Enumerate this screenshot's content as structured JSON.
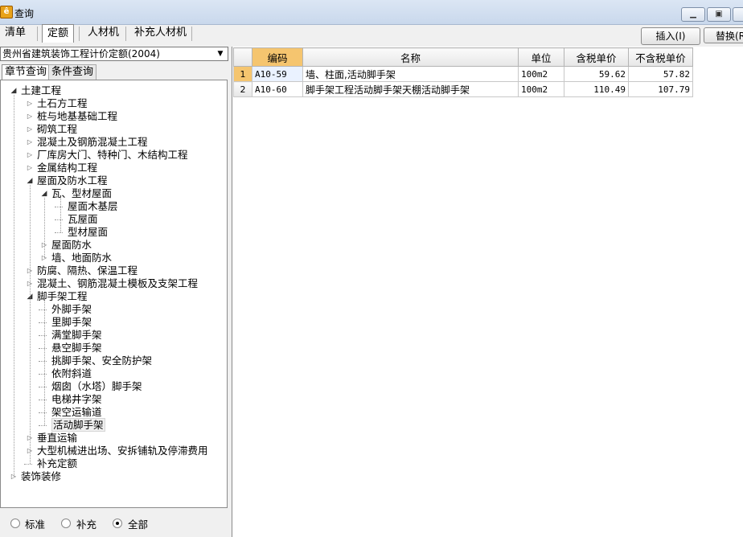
{
  "window": {
    "title": "查询",
    "icon": "app-icon",
    "buttons": {
      "minimize": "▭",
      "restore": "▣",
      "close": ""
    }
  },
  "tabs": [
    {
      "label": "清单",
      "active": false
    },
    {
      "label": "定额",
      "active": true
    },
    {
      "label": "人材机",
      "active": false
    },
    {
      "label": "补充人材机",
      "active": false
    }
  ],
  "toolbar": {
    "insert_label": "插入(I)",
    "replace_label": "替换(R"
  },
  "left": {
    "dropdown_value": "贵州省建筑装饰工程计价定额(2004)",
    "subtabs": [
      {
        "label": "章节查询",
        "active": true
      },
      {
        "label": "条件查询",
        "active": false
      }
    ],
    "tree": [
      {
        "label": "土建工程",
        "level": 0,
        "state": "expanded"
      },
      {
        "label": "土石方工程",
        "level": 1,
        "state": "collapsed"
      },
      {
        "label": "桩与地基基础工程",
        "level": 1,
        "state": "collapsed"
      },
      {
        "label": "砌筑工程",
        "level": 1,
        "state": "collapsed"
      },
      {
        "label": "混凝土及钢筋混凝土工程",
        "level": 1,
        "state": "collapsed"
      },
      {
        "label": "厂库房大门、特种门、木结构工程",
        "level": 1,
        "state": "collapsed"
      },
      {
        "label": "金属结构工程",
        "level": 1,
        "state": "collapsed"
      },
      {
        "label": "屋面及防水工程",
        "level": 1,
        "state": "expanded"
      },
      {
        "label": "瓦、型材屋面",
        "level": 2,
        "state": "expanded"
      },
      {
        "label": "屋面木基层",
        "level": 3,
        "state": "leaf"
      },
      {
        "label": "瓦屋面",
        "level": 3,
        "state": "leaf"
      },
      {
        "label": "型材屋面",
        "level": 3,
        "state": "leaf"
      },
      {
        "label": "屋面防水",
        "level": 2,
        "state": "collapsed"
      },
      {
        "label": "墙、地面防水",
        "level": 2,
        "state": "collapsed"
      },
      {
        "label": "防腐、隔热、保温工程",
        "level": 1,
        "state": "collapsed"
      },
      {
        "label": "混凝土、钢筋混凝土模板及支架工程",
        "level": 1,
        "state": "collapsed"
      },
      {
        "label": "脚手架工程",
        "level": 1,
        "state": "expanded"
      },
      {
        "label": "外脚手架",
        "level": 2,
        "state": "leaf"
      },
      {
        "label": "里脚手架",
        "level": 2,
        "state": "leaf"
      },
      {
        "label": "满堂脚手架",
        "level": 2,
        "state": "leaf"
      },
      {
        "label": "悬空脚手架",
        "level": 2,
        "state": "leaf"
      },
      {
        "label": "挑脚手架、安全防护架",
        "level": 2,
        "state": "leaf"
      },
      {
        "label": "依附斜道",
        "level": 2,
        "state": "leaf"
      },
      {
        "label": "烟囱（水塔）脚手架",
        "level": 2,
        "state": "leaf"
      },
      {
        "label": "电梯井字架",
        "level": 2,
        "state": "leaf"
      },
      {
        "label": "架空运输道",
        "level": 2,
        "state": "leaf"
      },
      {
        "label": "活动脚手架",
        "level": 2,
        "state": "leaf",
        "selected": true
      },
      {
        "label": "垂直运输",
        "level": 1,
        "state": "collapsed"
      },
      {
        "label": "大型机械进出场、安拆铺轨及停滞费用",
        "level": 1,
        "state": "collapsed"
      },
      {
        "label": "补充定额",
        "level": 1,
        "state": "leaf"
      },
      {
        "label": "装饰装修",
        "level": 0,
        "state": "collapsed"
      }
    ],
    "radios": [
      {
        "label": "标准",
        "checked": false
      },
      {
        "label": "补充",
        "checked": false
      },
      {
        "label": "全部",
        "checked": true
      }
    ]
  },
  "table": {
    "columns": [
      "编码",
      "名称",
      "单位",
      "含税单价",
      "不含税单价"
    ],
    "rows": [
      {
        "index": "1",
        "code": "A10-59",
        "name": "墙、柱面,活动脚手架",
        "unit": "100m2",
        "price_tax": "59.62",
        "price_notax": "57.82"
      },
      {
        "index": "2",
        "code": "A10-60",
        "name": "脚手架工程活动脚手架天棚活动脚手架",
        "unit": "100m2",
        "price_tax": "110.49",
        "price_notax": "107.79"
      }
    ]
  },
  "colors": {
    "header_highlight": "#f5c56f",
    "titlebar": "#c9d8ec"
  }
}
